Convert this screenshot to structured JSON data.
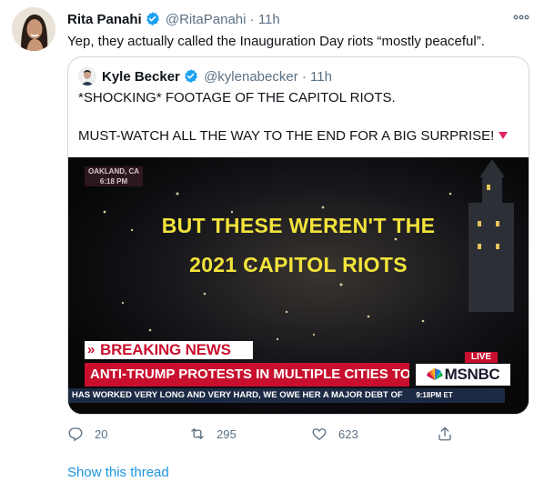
{
  "tweet": {
    "author_name": "Rita Panahi",
    "author_handle": "@RitaPanahi",
    "time": "11h",
    "text": "Yep, they actually called the Inauguration Day riots “mostly peaceful”.",
    "more_icon": "more-dots-icon"
  },
  "quoted": {
    "author_name": "Kyle Becker",
    "author_handle": "@kylenabecker",
    "time": "11h",
    "line1": "*SHOCKING* FOOTAGE OF THE CAPITOL RIOTS.",
    "line2": "MUST-WATCH ALL THE WAY TO THE END FOR A BIG SURPRISE!",
    "emoji": "red-triangle-down-icon"
  },
  "video": {
    "location": "OAKLAND, CA",
    "clock": "6:18 PM",
    "caption_line1": "BUT THESE WEREN'T THE",
    "caption_line2": "2021 CAPITOL RIOTS",
    "breaking_label": "BREAKING NEWS",
    "headline": "ANTI-TRUMP PROTESTS IN MULTIPLE CITIES TONIGHT",
    "live": "LIVE",
    "network": "MSNBC",
    "ticker": "HAS WORKED VERY LONG AND VERY HARD, WE OWE HER A MAJOR DEBT OF",
    "ticker_time": "9:18PM ET",
    "colors": {
      "breaking_red": "#c8102e",
      "caption_yellow": "#f2e33b"
    }
  },
  "actions": {
    "replies": "20",
    "retweets": "295",
    "likes": "623"
  },
  "show_thread": "Show this thread",
  "colors": {
    "link": "#1b95e0",
    "muted": "#5b7083",
    "verified": "#1da1f2"
  }
}
